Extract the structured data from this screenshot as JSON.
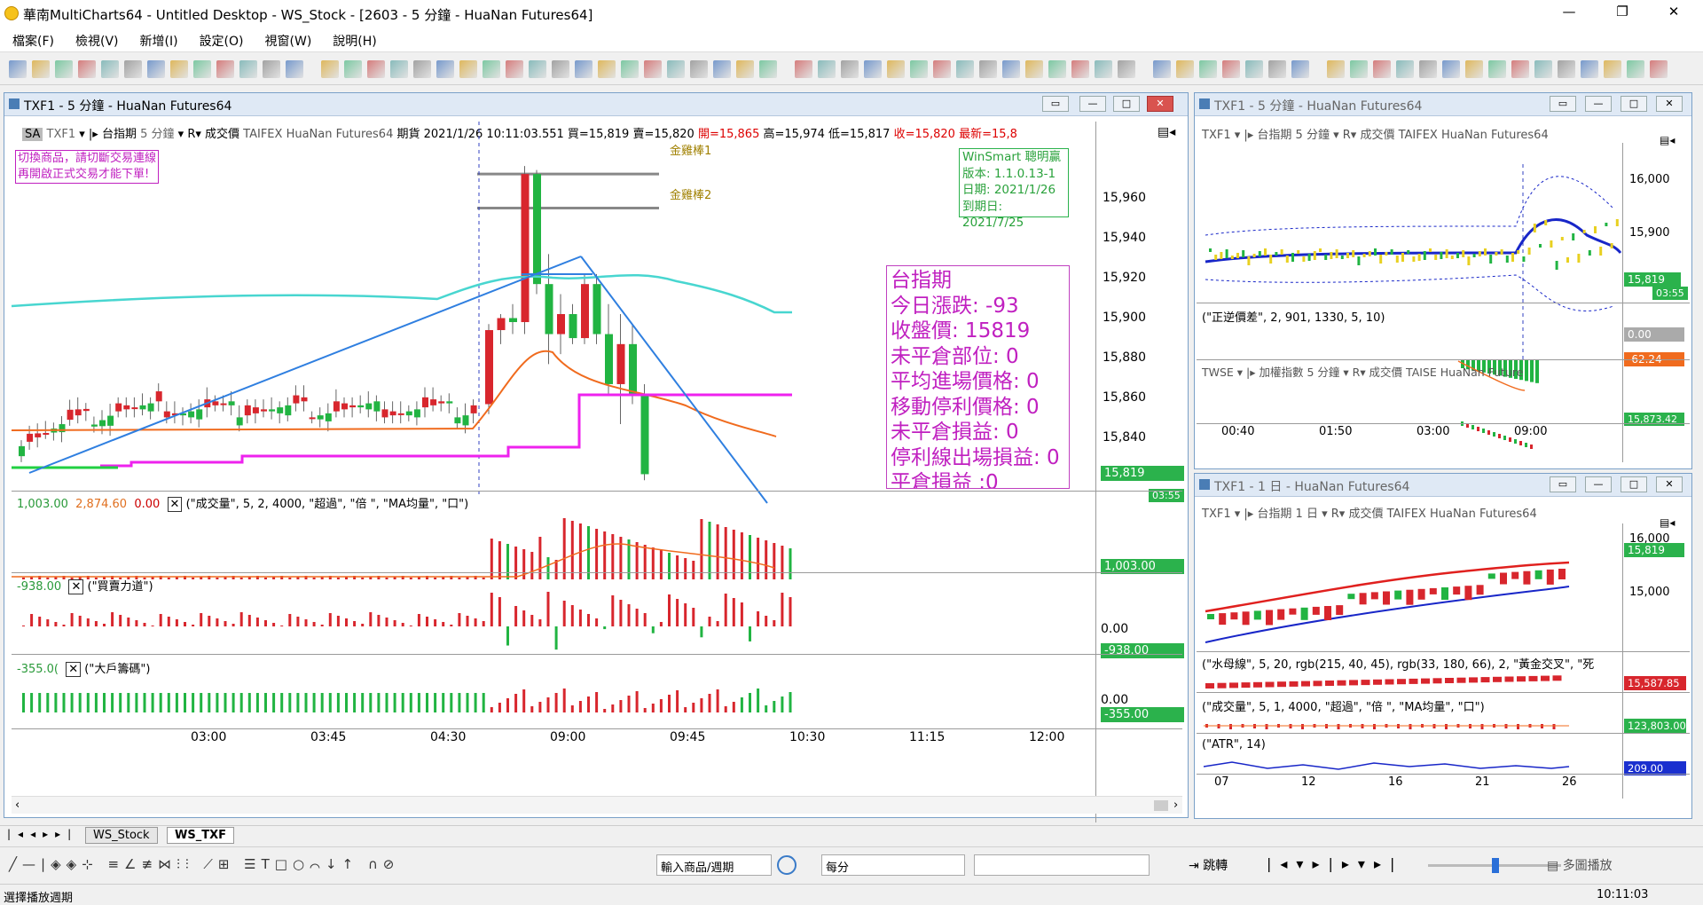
{
  "app": {
    "title": "華南MultiCharts64 - Untitled Desktop - WS_Stock - [2603 - 5 分鐘 - HuaNan Futures64]"
  },
  "menu": [
    "檔案(F)",
    "檢視(V)",
    "新增(I)",
    "設定(O)",
    "視窗(W)",
    "說明(H)"
  ],
  "main_chart": {
    "title": "TXF1 - 5 分鐘 - HuaNan Futures64",
    "header": {
      "sa": "SA",
      "symbol": "TXF1",
      "name": "台指期",
      "interval": "5 分鐘",
      "price_type": "成交價",
      "exchange": "TAIFEX",
      "feed": "HuaNan Futures64",
      "kind": "期貨",
      "datetime": "2021/1/26 10:11:03.551",
      "bid": "買=15,819",
      "ask": "賣=15,820",
      "open": "開=15,865",
      "high": "高=15,974",
      "low": "低=15,817",
      "close": "收=15,820",
      "last": "最新=15,8"
    },
    "warning": [
      "切換商品，請切斷交易連線",
      "再開啟正式交易才能下單!"
    ],
    "label1": "金雞棒1",
    "label2": "金雞棒2",
    "winsmart": [
      "WinSmart 聰明贏",
      "版本: 1.1.0.13-1",
      "日期: 2021/1/26",
      "到期日: 2021/7/25"
    ],
    "info": [
      "台指期",
      "今日漲跌: -93",
      "收盤價: 15819",
      "未平倉部位: 0",
      "平均進場價格: 0",
      "移動停利價格: 0",
      "未平倉損益: 0",
      "停利線出場損益: 0",
      "平倉損益 :0"
    ],
    "price_axis": [
      "15,960",
      "15,940",
      "15,920",
      "15,900",
      "15,880",
      "15,860",
      "15,840"
    ],
    "last_tag": "15,819",
    "timer": "03:55",
    "vol": {
      "v1": "1,003.00",
      "v2": "2,874.60",
      "v3": "0.00",
      "formula": "(\"成交量\", 5, 2, 4000, \"超過\", \"倍 \", \"MA均量\", \"口\")",
      "tag": "1,003.00"
    },
    "bs": {
      "v1": "-938.00",
      "formula": "(\"買賣力道\")",
      "axis0": "0.00",
      "tag": "-938.00"
    },
    "big": {
      "v1": "-355.0(",
      "formula": "(\"大戶籌碼\")",
      "axis0": "0.00",
      "tag": "-355.00"
    },
    "time_axis": [
      "03:00",
      "03:45",
      "04:30",
      "09:00",
      "09:45",
      "10:30",
      "11:15",
      "12:00"
    ]
  },
  "right_top": {
    "title": "TXF1 - 5 分鐘 - HuaNan Futures64",
    "header": "TXF1  ▾  |▸ 台指期  5 分鐘  ▾  R▾  成交價  TAIFEX  HuaNan Futures64",
    "axis": [
      "16,000",
      "15,900"
    ],
    "tag1": "15,819",
    "tag2": "15,8",
    "timer": "03:55",
    "sub1": {
      "formula": "(\"正逆價差\",  2,  901,  1330,  5,  10)",
      "v0": "0.00",
      "tag": "-62.24"
    },
    "sub2": {
      "header": "TWSE  ▾  |▸ 加權指數  5 分鐘  ▾  R▾  成交價  TAISE  HuaNan Future",
      "tag": "15,873.42"
    },
    "time_axis": [
      "00:40",
      "01:50",
      "03:00",
      "09:00"
    ]
  },
  "right_bottom": {
    "title": "TXF1 - 1 日 - HuaNan Futures64",
    "header": "TXF1  ▾  |▸ 台指期  1 日  ▾  R▾  成交價  TAIFEX  HuaNan Futures64",
    "axis": [
      "16,000",
      "15,000"
    ],
    "tag": "15,819",
    "sub1": {
      "formula": "(\"水母線\",  5,  20,  rgb(215, 40, 45),  rgb(33, 180, 66),  2,  \"黃金交叉\",  \"死",
      "tag": "15,587.85"
    },
    "sub2": {
      "formula": "(\"成交量\",  5,  1,  4000,  \"超過\",  \"倍 \",  \"MA均量\",  \"口\")",
      "tag": "123,803.00"
    },
    "sub3": {
      "formula": "(\"ATR\",  14)",
      "tag": "209.00"
    },
    "time_axis": [
      "07",
      "12",
      "16",
      "21",
      "26"
    ]
  },
  "tabs": [
    "WS_Stock",
    "WS_TXF"
  ],
  "bottom_toolbar": {
    "symbol_combo": "輸入商品/週期",
    "interval_combo": "每分",
    "jump": "跳轉",
    "multi": "多圖播放"
  },
  "status": {
    "left": "選擇播放週期",
    "time": "10:11:03"
  },
  "chart_data": {
    "type": "candlestick",
    "title": "TXF1 - 5 分鐘",
    "ylim": [
      15810,
      15990
    ],
    "candles_afternoon_session": "night session 02:25-05:00 flat around 15,845-15,860",
    "candles_day": [
      {
        "t": "08:45",
        "o": 15855,
        "h": 15895,
        "l": 15850,
        "c": 15892
      },
      {
        "t": "08:50",
        "o": 15892,
        "h": 15900,
        "l": 15885,
        "c": 15898
      },
      {
        "t": "08:55",
        "o": 15898,
        "h": 15905,
        "l": 15890,
        "c": 15896
      },
      {
        "t": "09:00",
        "o": 15896,
        "h": 15974,
        "l": 15890,
        "c": 15970
      },
      {
        "t": "09:05",
        "o": 15970,
        "h": 15972,
        "l": 15910,
        "c": 15915
      },
      {
        "t": "09:10",
        "o": 15915,
        "h": 15930,
        "l": 15875,
        "c": 15890
      },
      {
        "t": "09:15",
        "o": 15890,
        "h": 15910,
        "l": 15880,
        "c": 15900
      },
      {
        "t": "09:20",
        "o": 15900,
        "h": 15905,
        "l": 15885,
        "c": 15888
      },
      {
        "t": "09:25",
        "o": 15888,
        "h": 15920,
        "l": 15885,
        "c": 15915
      },
      {
        "t": "09:30",
        "o": 15915,
        "h": 15920,
        "l": 15885,
        "c": 15890
      },
      {
        "t": "09:35",
        "o": 15890,
        "h": 15905,
        "l": 15860,
        "c": 15865
      },
      {
        "t": "09:40",
        "o": 15865,
        "h": 15900,
        "l": 15845,
        "c": 15885
      },
      {
        "t": "09:45",
        "o": 15885,
        "h": 15895,
        "l": 15855,
        "c": 15860
      },
      {
        "t": "09:50",
        "o": 15860,
        "h": 15865,
        "l": 15817,
        "c": 15820
      }
    ]
  }
}
